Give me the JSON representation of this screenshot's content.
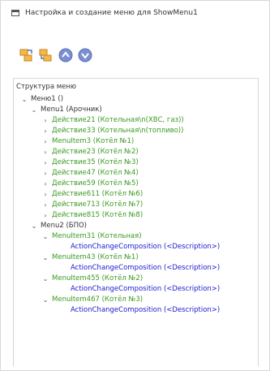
{
  "window": {
    "title": "Настройка и создание меню для ShowMenu1"
  },
  "toolbar": {
    "buttons": [
      {
        "icon": "add-item-icon"
      },
      {
        "icon": "add-subitem-icon"
      },
      {
        "icon": "move-up-icon"
      },
      {
        "icon": "move-down-icon"
      }
    ]
  },
  "panel": {
    "header": "Структура меню"
  },
  "tree": {
    "root": {
      "label": "Меню1 ()",
      "expanded": true
    },
    "menu1": {
      "label": "Menu1 (Арочник)",
      "expanded": true
    },
    "menu1_items": [
      "Действие21 (Котельная\\n(ХВС, газ))",
      "Действие33 (Котельная\\n(топливо))",
      "MenuItem3 (Котёл №1)",
      "Действие23 (Котёл №2)",
      "Действие35 (Котёл №3)",
      "Действие47 (Котёл №4)",
      "Действие59 (Котёл №5)",
      "Действие611 (Котёл №6)",
      "Действие713 (Котёл №7)",
      "Действие815 (Котёл №8)"
    ],
    "menu2": {
      "label": "Menu2 (БПО)",
      "expanded": true
    },
    "menu2_items": [
      {
        "label": "MenuItem31 (Котельная)",
        "action": "ActionChangeComposition (<Description>)"
      },
      {
        "label": "MenuItem43 (Котёл №1)",
        "action": "ActionChangeComposition (<Description>)"
      },
      {
        "label": "MenuItem455 (Котёл №2)",
        "action": "ActionChangeComposition (<Description>)"
      },
      {
        "label": "MenuItem467 (Котёл №3)",
        "action": "ActionChangeComposition (<Description>)"
      }
    ]
  },
  "colors": {
    "green_item": "#3b9b22",
    "blue_action": "#1a1acd",
    "toolbar_orange": "#e8a13a",
    "toolbar_blue": "#6f86c9"
  }
}
